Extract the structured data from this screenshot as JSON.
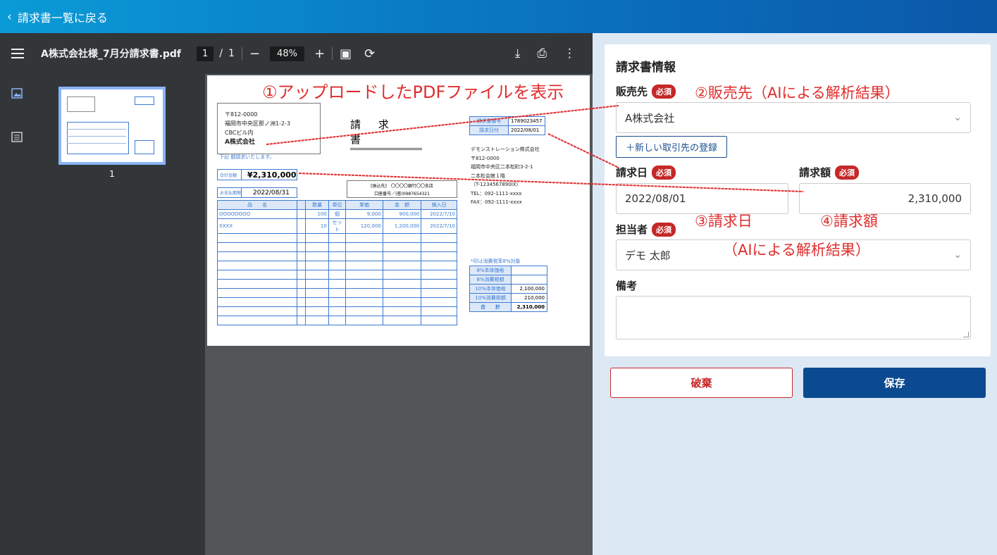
{
  "header": {
    "back_label": "請求書一覧に戻る"
  },
  "viewer": {
    "file_name": "A株式会社様_7月分請求書.pdf",
    "page_current": "1",
    "page_sep": "/",
    "page_total": "1",
    "zoom": "48%",
    "thumb_page_number": "1"
  },
  "document": {
    "annotation": "①アップロードしたPDFファイルを表示",
    "postal": "〒812-0000",
    "address": "福岡市中央区那ノ洲1-2-3",
    "building": "CBCビル内",
    "customer": "A株式会社",
    "title": "請 求 書",
    "note": "下記 御請求いたします。",
    "total_label": "合計金額",
    "total_value": "¥2,310,000",
    "due_label": "お支払期限",
    "due_value": "2022/08/31",
    "bank_line1": "[振込先]　〇〇〇〇銀行〇〇支店",
    "bank_line2": "口座番号／(普)0987654321",
    "item_headers": [
      "品　　名",
      "数量",
      "単位",
      "単価",
      "金　額",
      "納入日"
    ],
    "items": [
      [
        "OOOOOOOO",
        "100",
        "個",
        "9,000",
        "900,000",
        "2022/7/10"
      ],
      [
        "XXXX",
        "10",
        "セット",
        "120,000",
        "1,200,000",
        "2022/7/10"
      ]
    ],
    "meta": [
      {
        "key": "請求書番号",
        "value": "1789023457"
      },
      {
        "key": "請求日付",
        "value": "2022/08/01"
      }
    ],
    "seller_lines": [
      "デモンストレーション株式会社",
      "〒812-0000",
      "福岡市中央区二本松町3-2-1",
      "二本松会館１階",
      "（T-1234567890IX）",
      "TEL：092-1111-xxxx",
      "FAX：092-1111-xxxx"
    ],
    "tax_note": "*印は消費税率8%対象",
    "tax_rows": [
      {
        "key": "8%本体価格",
        "value": ""
      },
      {
        "key": "8%消費税額",
        "value": ""
      },
      {
        "key": "10%本体価格",
        "value": "2,100,000"
      },
      {
        "key": "10%消費税額",
        "value": "210,000"
      },
      {
        "key": "合　　計",
        "value": "2,310,000"
      }
    ]
  },
  "form": {
    "title": "請求書情報",
    "required_badge": "必須",
    "vendor_label": "販売先",
    "vendor_value": "A株式会社",
    "new_vendor_button": "＋新しい取引先の登録",
    "date_label": "請求日",
    "date_value": "2022/08/01",
    "amount_label": "請求額",
    "amount_value": "2,310,000",
    "person_label": "担当者",
    "person_value": "デモ 太郎",
    "memo_label": "備考",
    "discard_button": "破棄",
    "save_button": "保存"
  },
  "annotations": {
    "vendor": "②販売先（AIによる解析結果）",
    "date": "③請求日",
    "amount": "④請求額",
    "ai_result": "（AIによる解析結果）"
  },
  "colors": {
    "accent": "#0b4a90",
    "required": "#c62828",
    "annotation": "#e02d2d"
  }
}
